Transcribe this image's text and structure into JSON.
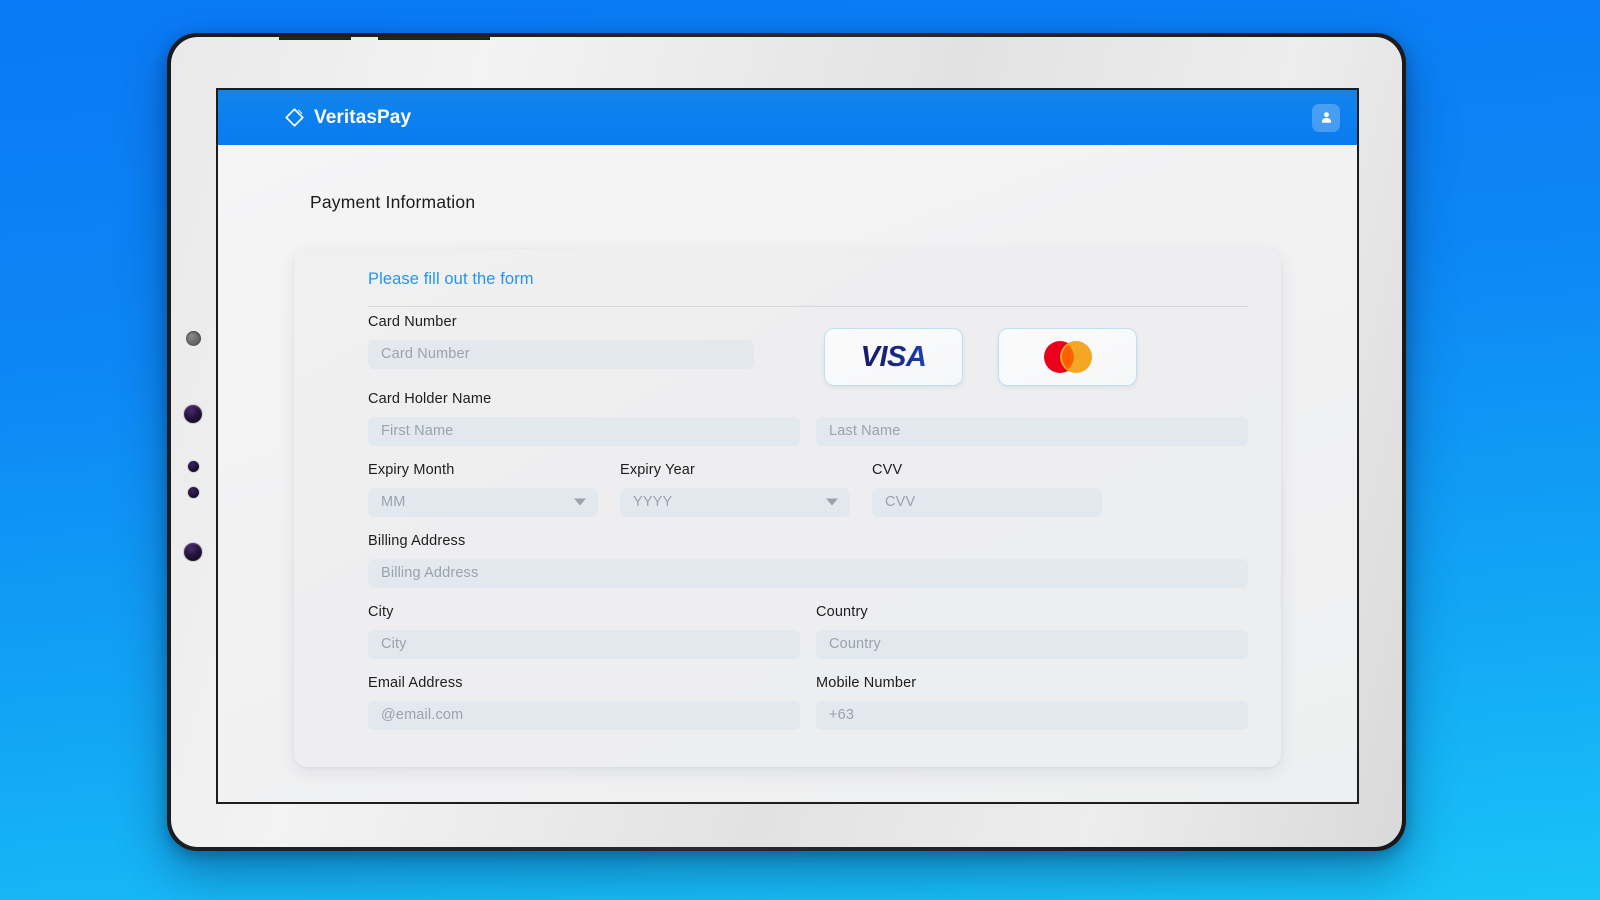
{
  "brand": {
    "name": "VeritasPay",
    "logo_icon": "diamond-outline-icon",
    "bar_color": "#0c80ef"
  },
  "appbar": {
    "account_icon": "user-avatar-icon"
  },
  "page": {
    "title": "Payment Information"
  },
  "form": {
    "heading": "Please fill out the form",
    "heading_color": "#2196f3",
    "fields": {
      "card_number": {
        "label": "Card Number",
        "placeholder": "Card Number",
        "value": ""
      },
      "card_holder": {
        "label": "Card Holder Name",
        "first_name_placeholder": "First Name",
        "first_name_value": "",
        "last_name_placeholder": "Last Name",
        "last_name_value": ""
      },
      "expiry_month": {
        "label": "Expiry Month",
        "placeholder": "MM",
        "value": "",
        "icon": "chevron-down-icon"
      },
      "expiry_year": {
        "label": "Expiry Year",
        "placeholder": "YYYY",
        "value": "",
        "icon": "chevron-down-icon"
      },
      "cvv": {
        "label": "CVV",
        "placeholder": "CVV",
        "value": ""
      },
      "billing_address": {
        "label": "Billing Address",
        "placeholder": "Billing Address",
        "value": ""
      },
      "city": {
        "label": "City",
        "placeholder": "City",
        "value": ""
      },
      "country": {
        "label": "Country",
        "placeholder": "Country",
        "value": ""
      },
      "email": {
        "label": "Email Address",
        "placeholder": "@email.com",
        "value": ""
      },
      "mobile": {
        "label": "Mobile Number",
        "placeholder": "+63",
        "value": ""
      }
    },
    "card_brands": [
      {
        "name": "VISA",
        "icon": "visa-logo-icon",
        "color": "#1a237e"
      },
      {
        "name": "Mastercard",
        "icon": "mastercard-logo-icon",
        "colors": [
          "#eb001b",
          "#f5a623",
          "#ff5f00"
        ]
      }
    ]
  },
  "theme": {
    "background_top": "#0a79f5",
    "background_bottom": "#19c4f7",
    "input_background": "#e3e9ef",
    "placeholder_color": "#9aa3ab",
    "label_color": "#1d1d1d"
  }
}
